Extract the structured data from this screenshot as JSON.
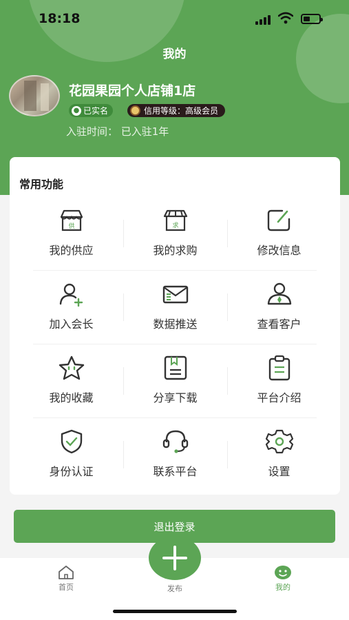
{
  "status": {
    "time": "18:18"
  },
  "header": {
    "title": "我的"
  },
  "profile": {
    "shop_name": "花园果园个人店铺1店",
    "verified_badge": "已实名",
    "credit_badge": "信用等级：高级会员",
    "join_time": "入驻时间： 已入驻1年"
  },
  "functions": {
    "title": "常用功能",
    "items": [
      {
        "label": "我的供应",
        "icon": "supply-store-icon",
        "glyph": "供"
      },
      {
        "label": "我的求购",
        "icon": "purchase-store-icon",
        "glyph": "求"
      },
      {
        "label": "修改信息",
        "icon": "edit-icon"
      },
      {
        "label": "加入会长",
        "icon": "add-user-icon"
      },
      {
        "label": "数据推送",
        "icon": "envelope-icon"
      },
      {
        "label": "查看客户",
        "icon": "customer-icon"
      },
      {
        "label": "我的收藏",
        "icon": "star-icon"
      },
      {
        "label": "分享下载",
        "icon": "share-document-icon"
      },
      {
        "label": "平台介绍",
        "icon": "clipboard-icon"
      },
      {
        "label": "身份认证",
        "icon": "shield-check-icon"
      },
      {
        "label": "联系平台",
        "icon": "headset-icon"
      },
      {
        "label": "设置",
        "icon": "gear-icon"
      }
    ]
  },
  "logout_label": "退出登录",
  "tabbar": {
    "tabs": [
      {
        "label": "首页",
        "icon": "home-icon"
      },
      {
        "label": "发布",
        "icon": "plus-icon"
      },
      {
        "label": "我的",
        "icon": "profile-face-icon"
      }
    ]
  },
  "colors": {
    "accent": "#5ca555",
    "text": "#333333",
    "credit_badge_bg": "#2a1b1b"
  }
}
